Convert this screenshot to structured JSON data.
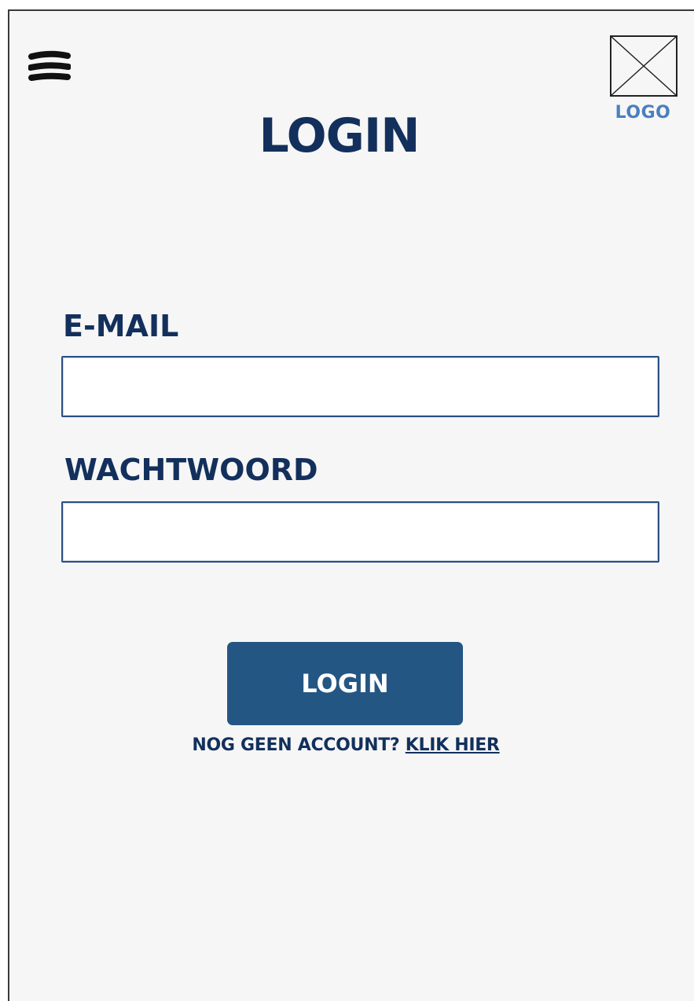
{
  "header": {
    "menu_icon": "hamburger-menu-icon",
    "logo_icon": "image-placeholder-icon",
    "logo_label": "LOGO",
    "title": "LOGIN"
  },
  "form": {
    "email_label": "E-MAIL",
    "email_value": "",
    "password_label": "WACHTWOORD",
    "password_value": "",
    "submit_label": "LOGIN"
  },
  "signup": {
    "prompt": "NOG GEEN ACCOUNT?",
    "link_label": "KLIK HIER"
  },
  "colors": {
    "background": "#f6f6f6",
    "primary_text": "#13305c",
    "button": "#245684",
    "logo_text": "#4a7fc0",
    "input_border": "#2b4f86"
  }
}
